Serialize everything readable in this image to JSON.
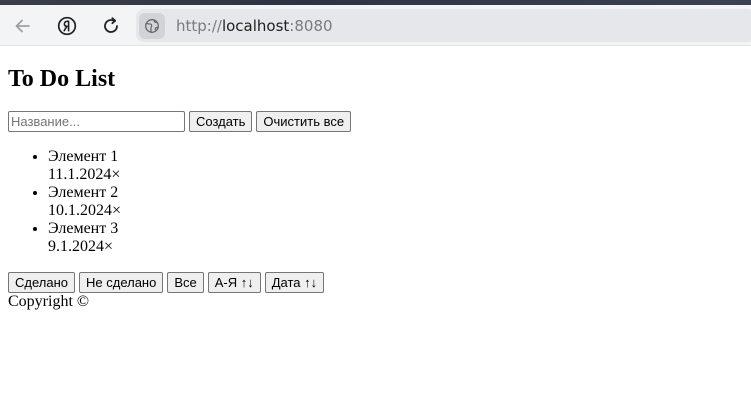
{
  "browser": {
    "url_scheme": "http://",
    "url_host": "localhost",
    "url_port": ":8080"
  },
  "page": {
    "title": "To Do List"
  },
  "create_form": {
    "placeholder": "Название...",
    "create_label": "Создать",
    "clear_all_label": "Очистить все"
  },
  "todos": [
    {
      "name": "Элемент 1",
      "date": "11.1.2024",
      "delete": "×"
    },
    {
      "name": "Элемент 2",
      "date": "10.1.2024",
      "delete": "×"
    },
    {
      "name": "Элемент 3",
      "date": "9.1.2024",
      "delete": "×"
    }
  ],
  "filters": {
    "done_label": "Сделано",
    "not_done_label": "Не сделано",
    "all_label": "Все",
    "sort_az_label": "А-Я ↑↓",
    "sort_date_label": "Дата ↑↓"
  },
  "footer": {
    "text": "Copyright ©"
  },
  "icons": {
    "back": "arrow-left-icon",
    "yandex": "yandex-logo-icon",
    "reload": "reload-icon",
    "site": "globe-icon"
  }
}
